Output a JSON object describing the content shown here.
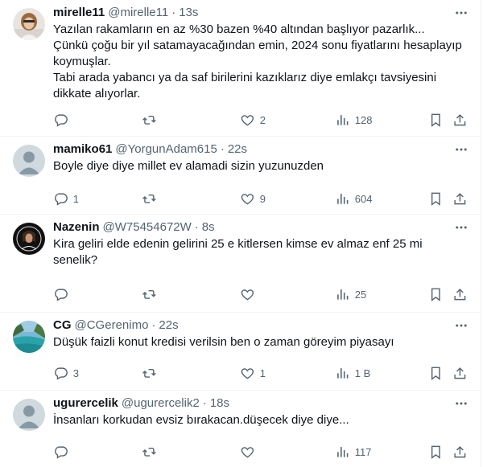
{
  "tweets": [
    {
      "name": "mirelle11",
      "handle": "@mirelle11",
      "sep": "·",
      "time": "13s",
      "text": "Yazılan rakamların en az %30 bazen %40 altından başlıyor pazarlık...\nÇünkü çoğu bir yıl satamayacağından emin, 2024 sonu fiyatlarını hesaplayıp koymuşlar.\nTabi arada yabancı ya da saf birilerini kazıklarız diye emlakçı tavsiyesini dikkate alıyorlar.",
      "replies": "",
      "retweets": "",
      "likes": "2",
      "views": "128",
      "avatar": "photo-woman"
    },
    {
      "name": "mamiko61",
      "handle": "@YorgunAdam615",
      "sep": "·",
      "time": "22s",
      "text": "Boyle diye diye millet ev alamadi sizin yuzunuzden",
      "replies": "1",
      "retweets": "",
      "likes": "9",
      "views": "604",
      "avatar": "default"
    },
    {
      "name": "Nazenin",
      "handle": "@W75454672W",
      "sep": "·",
      "time": "8s",
      "text": "Kira geliri elde edenin gelirini 25 e kitlersen kimse ev almaz enf 25 mi senelik?",
      "replies": "",
      "retweets": "",
      "likes": "",
      "views": "25",
      "avatar": "photo-girl"
    },
    {
      "name": "CG",
      "handle": "@CGerenimo",
      "sep": "·",
      "time": "22s",
      "text": "Düşük faizli konut kredisi verilsin ben o zaman göreyim piyasayı",
      "replies": "3",
      "retweets": "",
      "likes": "1",
      "views": "1 B",
      "avatar": "photo-lake"
    },
    {
      "name": "ugurercelik",
      "handle": "@ugurercelik2",
      "sep": "·",
      "time": "18s",
      "text": "İnsanları korkudan evsiz bırakacan.düşecek diye diye...",
      "replies": "",
      "retweets": "",
      "likes": "",
      "views": "117",
      "avatar": "default"
    }
  ],
  "colors": {
    "text": "#0f1419",
    "muted": "#536471",
    "divider": "#eff3f4",
    "default_avatar": "#cfd9de"
  },
  "icons": [
    "more-icon",
    "reply-icon",
    "retweet-icon",
    "like-icon",
    "views-icon",
    "bookmark-icon",
    "share-icon"
  ]
}
